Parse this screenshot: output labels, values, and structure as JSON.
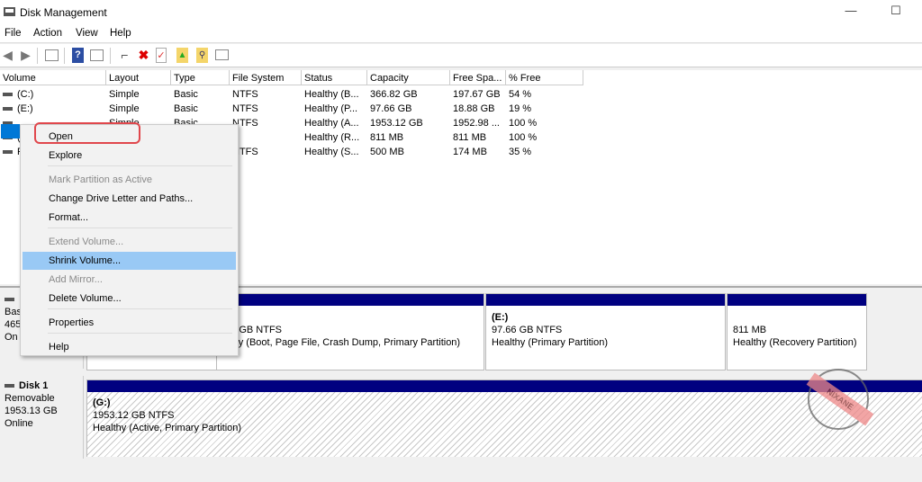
{
  "window": {
    "title": "Disk Management",
    "minimize": "—",
    "maximize": "☐"
  },
  "menubar": [
    "File",
    "Action",
    "View",
    "Help"
  ],
  "toolbar": [
    {
      "icon": "back-arrow-icon"
    },
    {
      "icon": "forward-arrow-icon"
    },
    {
      "icon": "console-tree-icon"
    },
    {
      "icon": "help-icon"
    },
    {
      "icon": "action-pane-icon"
    },
    {
      "icon": "connect-icon"
    },
    {
      "icon": "delete-icon"
    },
    {
      "icon": "check-icon"
    },
    {
      "icon": "folder-up-icon"
    },
    {
      "icon": "folder-search-icon"
    },
    {
      "icon": "properties-icon"
    }
  ],
  "table": {
    "columns": [
      "Volume",
      "Layout",
      "Type",
      "File System",
      "Status",
      "Capacity",
      "Free Spa...",
      "% Free"
    ],
    "rows": [
      [
        "(C:)",
        "Simple",
        "Basic",
        "NTFS",
        "Healthy (B...",
        "366.82 GB",
        "197.67 GB",
        "54 %"
      ],
      [
        "(E:)",
        "Simple",
        "Basic",
        "NTFS",
        "Healthy (P...",
        "97.66 GB",
        "18.88 GB",
        "19 %"
      ],
      [
        "(G:)",
        "Simple",
        "Basic",
        "NTFS",
        "Healthy (A...",
        "1953.12 GB",
        "1952.98 ...",
        "100 %"
      ],
      [
        "(",
        "",
        "",
        "",
        "Healthy (R...",
        "811 MB",
        "811 MB",
        "100 %"
      ],
      [
        "R",
        "",
        "",
        "NTFS",
        "Healthy (S...",
        "500 MB",
        "174 MB",
        "35 %"
      ]
    ]
  },
  "disk0": {
    "label": [
      "Bas",
      "465",
      "On"
    ],
    "partitions": [
      {
        "name": ":)",
        "size": ".82 GB NTFS",
        "status": "althy (Boot, Page File, Crash Dump, Primary Partition)"
      },
      {
        "name": "(E:)",
        "size": "97.66 GB NTFS",
        "status": "Healthy (Primary Partition)"
      },
      {
        "name": "",
        "size": "811 MB",
        "status": "Healthy (Recovery Partition)"
      }
    ]
  },
  "disk1": {
    "name": "Disk 1",
    "type": "Removable",
    "size": "1953.13 GB",
    "state": "Online",
    "partition": {
      "name": "(G:)",
      "size": "1953.12 GB NTFS",
      "status": "Healthy (Active, Primary Partition)"
    }
  },
  "context_menu": [
    {
      "label": "Open",
      "enabled": true
    },
    {
      "label": "Explore",
      "enabled": true
    },
    {
      "label": "Mark Partition as Active",
      "enabled": false
    },
    {
      "label": "Change Drive Letter and Paths...",
      "enabled": true
    },
    {
      "label": "Format...",
      "enabled": true
    },
    {
      "label": "Extend Volume...",
      "enabled": false
    },
    {
      "label": "Shrink Volume...",
      "enabled": true,
      "highlighted": true
    },
    {
      "label": "Add Mirror...",
      "enabled": false
    },
    {
      "label": "Delete Volume...",
      "enabled": true
    },
    {
      "label": "Properties",
      "enabled": true
    },
    {
      "label": "Help",
      "enabled": true
    }
  ],
  "watermark": "NIXANE",
  "colors": {
    "partition_bar": "#000080",
    "highlight": "#99c9f5",
    "callout": "#e0474c",
    "selection": "#0078d7"
  }
}
